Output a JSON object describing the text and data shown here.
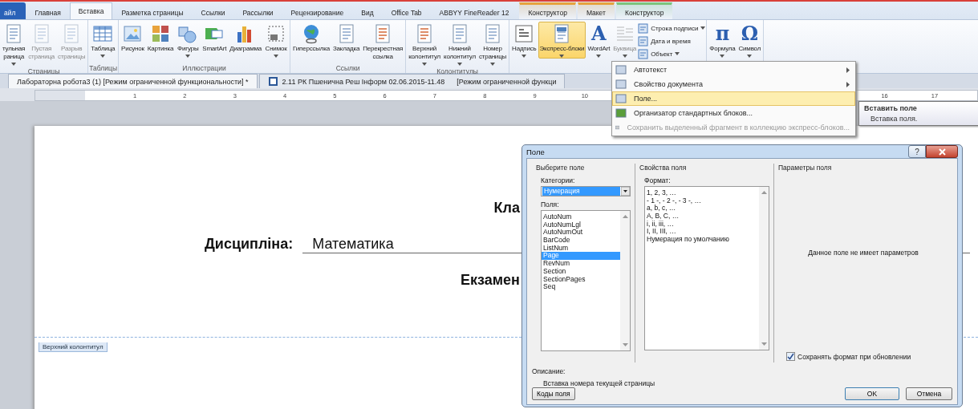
{
  "ribbon_tabs": [
    {
      "label": "айл",
      "kind": "file",
      "selected": false
    },
    {
      "label": "Главная",
      "kind": "normal",
      "selected": false
    },
    {
      "label": "Вставка",
      "kind": "normal",
      "selected": true
    },
    {
      "label": "Разметка страницы",
      "kind": "normal",
      "selected": false
    },
    {
      "label": "Ссылки",
      "kind": "normal",
      "selected": false
    },
    {
      "label": "Рассылки",
      "kind": "normal",
      "selected": false
    },
    {
      "label": "Рецензирование",
      "kind": "normal",
      "selected": false
    },
    {
      "label": "Вид",
      "kind": "normal",
      "selected": false
    },
    {
      "label": "Office Tab",
      "kind": "normal",
      "selected": false
    },
    {
      "label": "ABBYY FineReader 12",
      "kind": "normal",
      "selected": false
    },
    {
      "label": "Конструктор",
      "kind": "context",
      "color": "#e6a23c",
      "selected": false
    },
    {
      "label": "Макет",
      "kind": "context",
      "color": "#e6a23c",
      "selected": false
    },
    {
      "label": "Конструктор",
      "kind": "context",
      "color": "#7cc47c",
      "selected": false
    }
  ],
  "ribbon_groups": [
    {
      "label": "Страницы",
      "items": [
        {
          "kind": "large",
          "lines": [
            "тульная",
            "раница"
          ],
          "caret": true,
          "disabled": false,
          "pressed": false
        },
        {
          "kind": "large",
          "lines": [
            "Пустая",
            "страница"
          ],
          "caret": false,
          "disabled": true,
          "pressed": false
        },
        {
          "kind": "large",
          "lines": [
            "Разрыв",
            "страницы"
          ],
          "caret": false,
          "disabled": true,
          "pressed": false
        }
      ]
    },
    {
      "label": "Таблицы",
      "items": [
        {
          "kind": "large",
          "lines": [
            "Таблица"
          ],
          "caret": true,
          "disabled": false,
          "pressed": false
        }
      ]
    },
    {
      "label": "Иллюстрации",
      "items": [
        {
          "kind": "large",
          "lines": [
            "Рисунок"
          ],
          "caret": false,
          "disabled": false,
          "pressed": false
        },
        {
          "kind": "large",
          "lines": [
            "Картинка"
          ],
          "caret": false,
          "disabled": false,
          "pressed": false
        },
        {
          "kind": "large",
          "lines": [
            "Фигуры"
          ],
          "caret": true,
          "disabled": false,
          "pressed": false
        },
        {
          "kind": "large",
          "lines": [
            "SmartArt"
          ],
          "caret": false,
          "disabled": false,
          "pressed": false
        },
        {
          "kind": "large",
          "lines": [
            "Диаграмма"
          ],
          "caret": false,
          "disabled": false,
          "pressed": false
        },
        {
          "kind": "large",
          "lines": [
            "Снимок"
          ],
          "caret": true,
          "disabled": false,
          "pressed": false
        }
      ]
    },
    {
      "label": "Ссылки",
      "items": [
        {
          "kind": "large",
          "lines": [
            "Гиперссылка"
          ],
          "caret": false,
          "disabled": false,
          "pressed": false
        },
        {
          "kind": "large",
          "lines": [
            "Закладка"
          ],
          "caret": false,
          "disabled": false,
          "pressed": false
        },
        {
          "kind": "large",
          "lines": [
            "Перекрестная",
            "ссылка"
          ],
          "caret": false,
          "disabled": false,
          "pressed": false
        }
      ]
    },
    {
      "label": "Колонтитулы",
      "items": [
        {
          "kind": "large",
          "lines": [
            "Верхний",
            "колонтитул"
          ],
          "caret": true,
          "disabled": false,
          "pressed": false
        },
        {
          "kind": "large",
          "lines": [
            "Нижний",
            "колонтитул"
          ],
          "caret": true,
          "disabled": false,
          "pressed": false
        },
        {
          "kind": "large",
          "lines": [
            "Номер",
            "страницы"
          ],
          "caret": true,
          "disabled": false,
          "pressed": false
        }
      ]
    },
    {
      "items": [
        {
          "kind": "large",
          "lines": [
            "Надпись"
          ],
          "caret": true,
          "disabled": false,
          "pressed": false
        },
        {
          "kind": "large",
          "lines": [
            "Экспресс-блоки"
          ],
          "caret": true,
          "disabled": false,
          "pressed": true
        },
        {
          "kind": "large",
          "glyph": "A",
          "lines": [
            "WordArt"
          ],
          "caret": true,
          "disabled": false,
          "pressed": false
        },
        {
          "kind": "large",
          "lines": [
            "Буквица"
          ],
          "caret": true,
          "disabled": true,
          "pressed": false
        },
        {
          "kind": "stack",
          "entries": [
            {
              "label": "Строка подписи",
              "caret": true
            },
            {
              "label": "Дата и время",
              "caret": false
            },
            {
              "label": "Объект",
              "caret": true
            }
          ]
        }
      ]
    },
    {
      "items": [
        {
          "kind": "large",
          "glyph": "π",
          "lines": [
            "Формула"
          ],
          "caret": true,
          "disabled": false,
          "pressed": false
        },
        {
          "kind": "large",
          "glyph": "Ω",
          "lines": [
            "Символ"
          ],
          "caret": true,
          "disabled": false,
          "pressed": false
        }
      ]
    }
  ],
  "document_tabs": [
    {
      "title": "Лабораторна робота3 (1) [Режим ограниченной функциональности] *",
      "selected": true
    },
    {
      "title": "2.11 РК Пшенична Реш Інформ 02.06.2015-11.48",
      "mode": "[Режим ограниченной функци",
      "selected": false
    }
  ],
  "ruler": {
    "left_numbers": [
      "1",
      "2",
      "3",
      "4",
      "5",
      "6",
      "7",
      "8",
      "9",
      "10"
    ],
    "right_numbers": [
      "16",
      "17"
    ]
  },
  "document": {
    "line_1": "Кла",
    "discipline_label": "Дисципліна:",
    "discipline_value": "Математика",
    "line_3": "Екзамен",
    "header_tag": "Верхний колонтитул"
  },
  "quick_parts_menu": {
    "items": [
      {
        "label": "Автотекст",
        "submenu": true,
        "disabled": false,
        "selected": false
      },
      {
        "label": "Свойство документа",
        "submenu": true,
        "disabled": false,
        "selected": false
      },
      {
        "label": "Поле...",
        "submenu": false,
        "disabled": false,
        "selected": true
      },
      {
        "label": "Организатор стандартных блоков...",
        "submenu": false,
        "disabled": false,
        "selected": false
      },
      {
        "label": "Сохранить выделенный фрагмент в коллекцию экспресс-блоков...",
        "submenu": false,
        "disabled": true,
        "selected": false
      }
    ]
  },
  "tooltip": {
    "title": "Вставить поле",
    "text": "Вставка поля."
  },
  "dialog": {
    "title": "Поле",
    "help": "?",
    "choose_section": {
      "title": "Выберите поле",
      "categories_label": "Категории:",
      "category_value": "Нумерация",
      "fields_label": "Поля:",
      "fields": [
        {
          "label": "AutoNum",
          "selected": false
        },
        {
          "label": "AutoNumLgl",
          "selected": false
        },
        {
          "label": "AutoNumOut",
          "selected": false
        },
        {
          "label": "BarCode",
          "selected": false
        },
        {
          "label": "ListNum",
          "selected": false
        },
        {
          "label": "Page",
          "selected": true
        },
        {
          "label": "RevNum",
          "selected": false
        },
        {
          "label": "Section",
          "selected": false
        },
        {
          "label": "SectionPages",
          "selected": false
        },
        {
          "label": "Seq",
          "selected": false
        }
      ]
    },
    "properties_section": {
      "title": "Свойства поля",
      "format_label": "Формат:",
      "formats": [
        {
          "label": "1, 2, 3, …",
          "selected": false
        },
        {
          "label": "- 1 -, - 2 -, - 3 -, …",
          "selected": false
        },
        {
          "label": "a, b, c, …",
          "selected": false
        },
        {
          "label": "A, B, C, …",
          "selected": false
        },
        {
          "label": "i, ii, iii, …",
          "selected": false
        },
        {
          "label": "I, II, III, …",
          "selected": false
        },
        {
          "label": "Нумерация по умолчанию",
          "selected": false
        }
      ]
    },
    "options_section": {
      "title": "Параметры поля",
      "message": "Данное поле не имеет параметров",
      "preserve_label": "Сохранять формат при обновлении",
      "preserve_checked": true
    },
    "description_label": "Описание:",
    "description": "Вставка номера текущей страницы",
    "buttons": [
      {
        "label": "Коды поля",
        "kind": "left"
      },
      {
        "label": "OK",
        "kind": "default"
      },
      {
        "label": "Отмена",
        "kind": "normal"
      }
    ]
  }
}
